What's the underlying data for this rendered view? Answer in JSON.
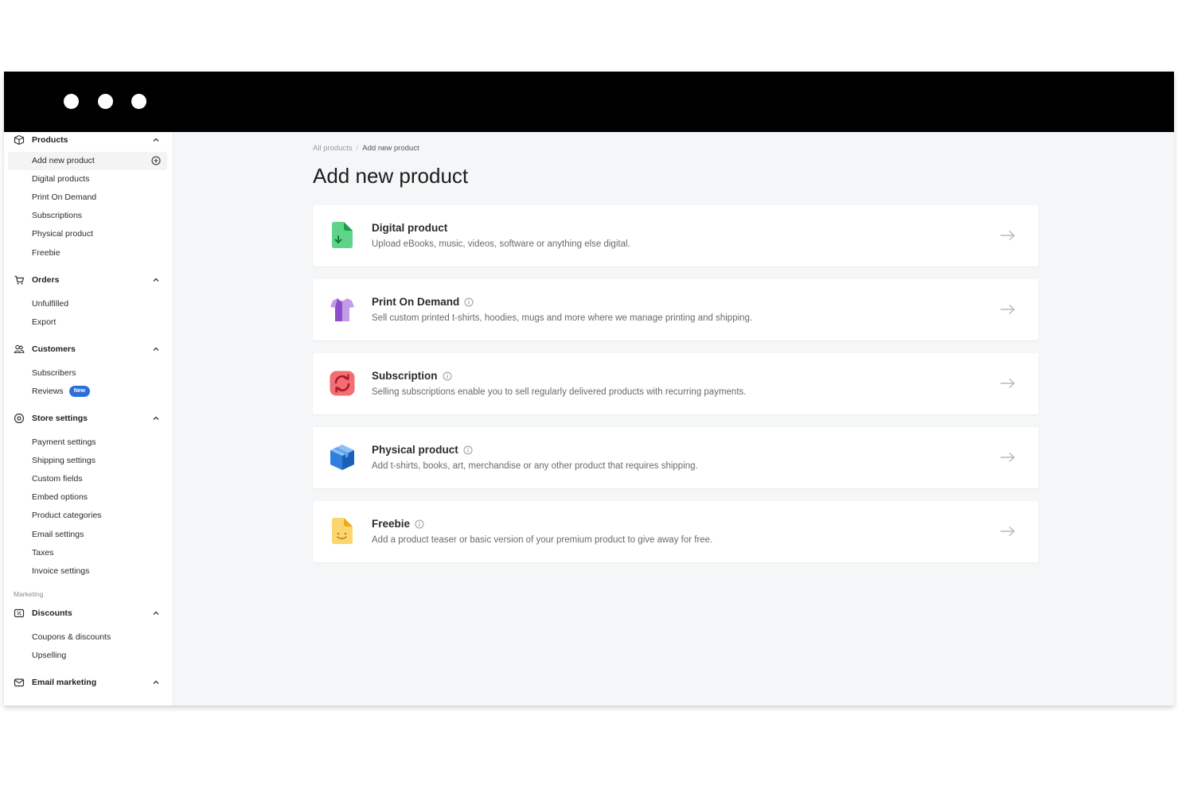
{
  "sidebar": {
    "sections": {
      "products": {
        "label": "Products",
        "items": [
          "Add new product",
          "Digital products",
          "Print On Demand",
          "Subscriptions",
          "Physical product",
          "Freebie"
        ]
      },
      "orders": {
        "label": "Orders",
        "items": [
          "Unfulfilled",
          "Export"
        ]
      },
      "customers": {
        "label": "Customers",
        "items": [
          "Subscribers",
          "Reviews"
        ],
        "reviews_badge": "New"
      },
      "store_settings": {
        "label": "Store settings",
        "items": [
          "Payment settings",
          "Shipping settings",
          "Custom fields",
          "Embed options",
          "Product categories",
          "Email settings",
          "Taxes",
          "Invoice settings"
        ]
      },
      "marketing_group": "Marketing",
      "discounts": {
        "label": "Discounts",
        "items": [
          "Coupons & discounts",
          "Upselling"
        ]
      },
      "email_marketing": {
        "label": "Email marketing"
      }
    }
  },
  "main": {
    "breadcrumb": {
      "parent": "All products",
      "current": "Add new product"
    },
    "title": "Add new product",
    "cards": [
      {
        "title": "Digital product",
        "desc": "Upload eBooks, music, videos, software or anything else digital.",
        "icon": "digital-file-icon",
        "color": "#3cc268"
      },
      {
        "title": "Print On Demand",
        "desc": "Sell custom printed t-shirts, hoodies, mugs and more where we manage printing and shipping.",
        "icon": "tshirt-icon",
        "color": "#9b59d0"
      },
      {
        "title": "Subscription",
        "desc": "Selling subscriptions enable you to sell regularly delivered products with recurring payments.",
        "icon": "refresh-icon",
        "color": "#f0505a"
      },
      {
        "title": "Physical product",
        "desc": "Add t-shirts, books, art, merchandise or any other product that requires shipping.",
        "icon": "box-icon",
        "color": "#2f7fe0"
      },
      {
        "title": "Freebie",
        "desc": "Add a product teaser or basic version of your premium product to give away for free.",
        "icon": "smiley-icon",
        "color": "#f9c341"
      }
    ]
  }
}
